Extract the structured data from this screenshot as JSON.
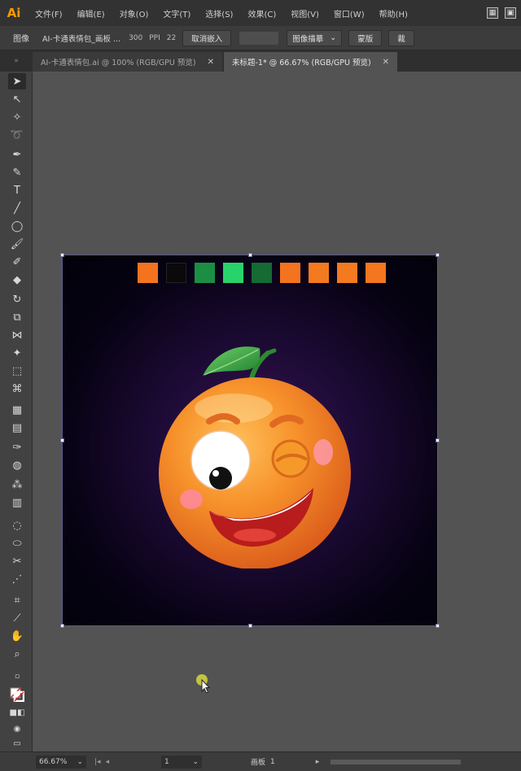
{
  "app": {
    "logo": "Ai"
  },
  "menu": {
    "items": [
      "文件(F)",
      "编辑(E)",
      "对象(O)",
      "文字(T)",
      "选择(S)",
      "效果(C)",
      "视图(V)",
      "窗口(W)",
      "帮助(H)"
    ]
  },
  "controlbar": {
    "mode_label": "图像",
    "filename": "AI-卡通表情包_画板 ...",
    "ppi_value": "300",
    "ppi_label": "PPI",
    "extra": "22",
    "unembed_button": "取消嵌入",
    "trace_dropdown": "图像描摹",
    "mask_button": "蒙版",
    "crop_button": "裁"
  },
  "tabs": [
    {
      "label": "AI-卡通表情包.ai @ 100% (RGB/GPU 预览)",
      "active": false
    },
    {
      "label": "未标题-1* @ 66.67% (RGB/GPU 预览)",
      "active": true
    }
  ],
  "artboard": {
    "swatch_colors": [
      "#f4731f",
      "#0a0a0a",
      "#1b8e44",
      "#28d46a",
      "#166a33",
      "#f4731f",
      "#f47a1f",
      "#f47a1f",
      "#f4761e"
    ]
  },
  "statusbar": {
    "zoom": "66.67%",
    "page": "1",
    "doc_label": "画板",
    "doc_value": "1"
  }
}
